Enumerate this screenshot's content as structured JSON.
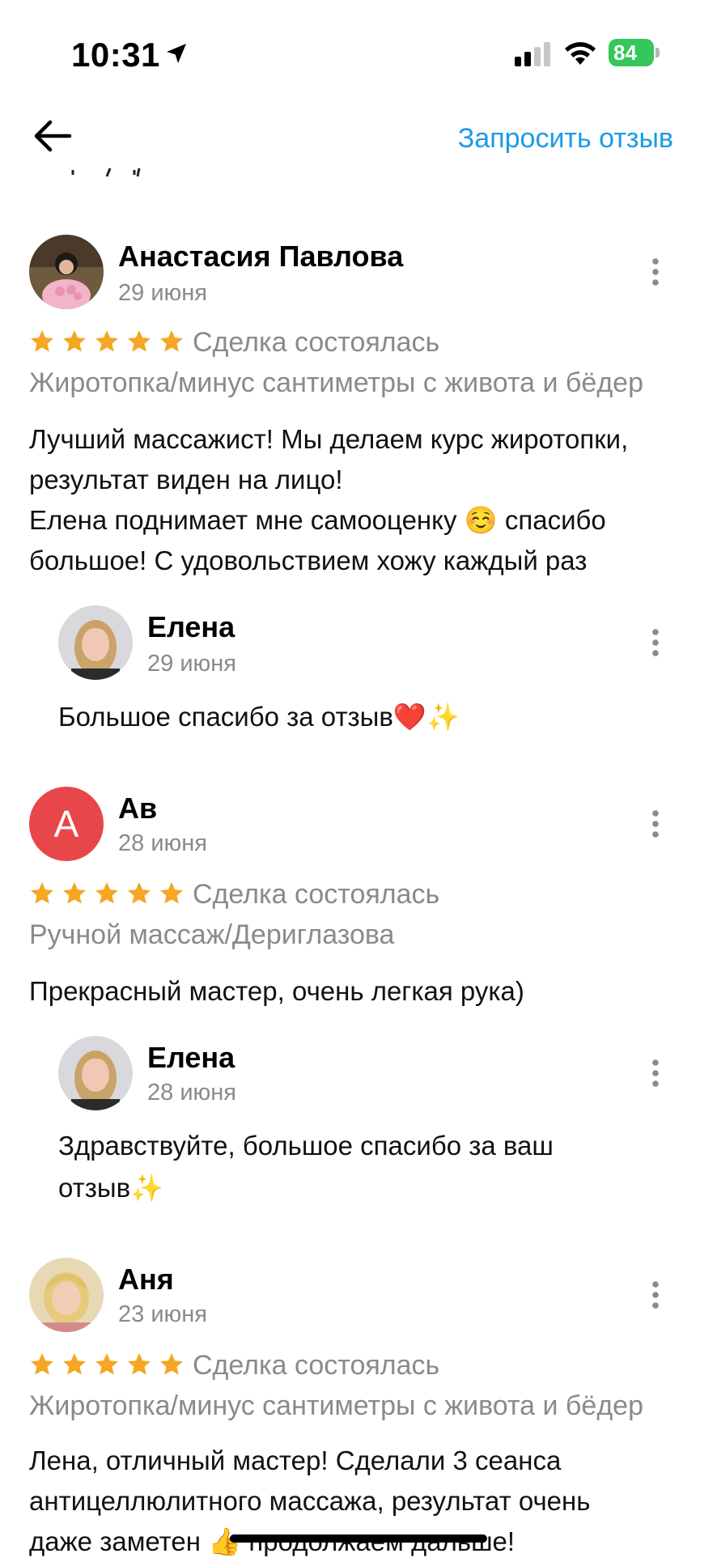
{
  "status_bar": {
    "time": "10:31",
    "battery": "84"
  },
  "nav": {
    "request_review": "Запросить отзыв"
  },
  "reviews": [
    {
      "author": "Анастасия Павлова",
      "date": "29 июня",
      "deal_status": "Сделка состоялась",
      "service": "Жиротопка/минус сантиметры с живота и бёдер",
      "text_lines": [
        "Лучший массажист! Мы делаем курс жиротопки,",
        "результат виден на лицо!",
        "Елена поднимает мне самооценку ☺️ спасибо",
        "большое! С удовольствием хожу каждый раз"
      ],
      "reply": {
        "author": "Елена",
        "date": "29 июня",
        "text": "Большое спасибо за отзыв❤️✨"
      }
    },
    {
      "author": "Ав",
      "avatar_letter": "А",
      "date": "28 июня",
      "deal_status": "Сделка состоялась",
      "service": "Ручной массаж/Дериглазова",
      "text_lines": [
        "Прекрасный мастер, очень легкая рука)"
      ],
      "reply": {
        "author": "Елена",
        "date": "28 июня",
        "text_lines": [
          "Здравствуйте, большое спасибо за ваш",
          "отзыв✨"
        ]
      }
    },
    {
      "author": "Аня",
      "date": "23 июня",
      "deal_status": "Сделка состоялась",
      "service": "Жиротопка/минус сантиметры с живота и бёдер",
      "text_lines": [
        "Лена, отличный мастер! Сделали 3 сеанса",
        "антицеллюлитного массажа, результат очень",
        "даже заметен 👍 продолжаем дальше!"
      ]
    }
  ],
  "colors": {
    "accent": "#1a9be8",
    "star": "#f5a623",
    "avatar_letter_bg": "#e8474a"
  },
  "icons": [
    "location-arrow-icon",
    "signal-icon",
    "wifi-icon",
    "battery-icon",
    "back-arrow-icon",
    "more-vertical-icon",
    "star-icon"
  ]
}
